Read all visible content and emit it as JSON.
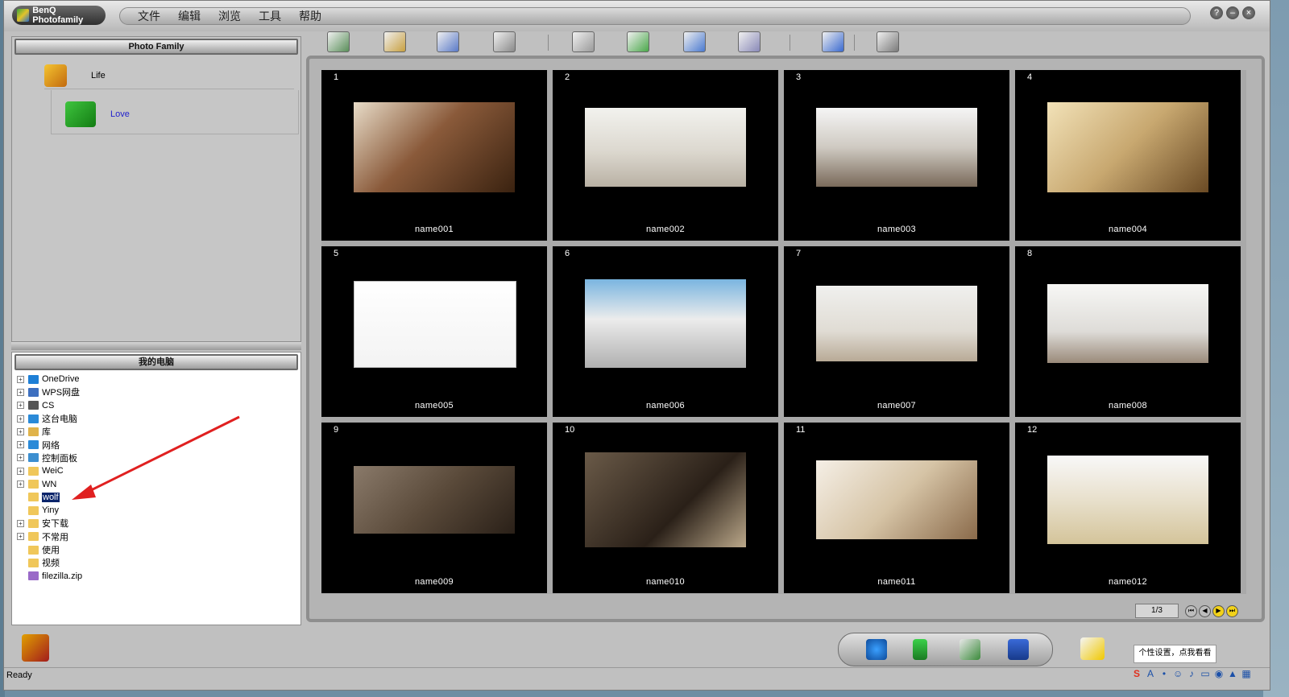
{
  "app": {
    "title": "BenQ Photofamily"
  },
  "menu": [
    "文件",
    "编辑",
    "浏览",
    "工具",
    "帮助"
  ],
  "window_buttons": [
    "?",
    "–",
    "×"
  ],
  "albums_panel": {
    "header": "Photo Family",
    "items": [
      {
        "label": "Life"
      },
      {
        "label": "Love"
      }
    ]
  },
  "tree_panel": {
    "header": "我的电脑",
    "items": [
      {
        "label": "OneDrive",
        "expander": "+",
        "icon": "cloud-icon"
      },
      {
        "label": "WPS网盘",
        "expander": "+",
        "icon": "cloud-outline-icon"
      },
      {
        "label": "CS",
        "expander": "+",
        "icon": "user-icon"
      },
      {
        "label": "这台电脑",
        "expander": "+",
        "icon": "monitor-icon"
      },
      {
        "label": "库",
        "expander": "+",
        "icon": "library-icon"
      },
      {
        "label": "网络",
        "expander": "+",
        "icon": "network-icon"
      },
      {
        "label": "控制面板",
        "expander": "+",
        "icon": "control-panel-icon"
      },
      {
        "label": "WeiC",
        "expander": "+",
        "icon": "folder-icon"
      },
      {
        "label": "WN",
        "expander": "+",
        "icon": "folder-icon"
      },
      {
        "label": "wolf",
        "expander": "",
        "icon": "folder-icon",
        "selected": true
      },
      {
        "label": "Yiny",
        "expander": "",
        "icon": "folder-icon"
      },
      {
        "label": "安下载",
        "expander": "+",
        "icon": "folder-icon"
      },
      {
        "label": "不常用",
        "expander": "+",
        "icon": "folder-icon"
      },
      {
        "label": "使用",
        "expander": "",
        "icon": "folder-icon"
      },
      {
        "label": "视频",
        "expander": "",
        "icon": "folder-icon"
      },
      {
        "label": "filezilla.zip",
        "expander": "",
        "icon": "zip-icon"
      }
    ]
  },
  "toolbar_icons": [
    "import-photo-icon",
    "album-icon",
    "scanner-icon",
    "save-disk-icon",
    "print-icon",
    "map-icon",
    "view-icon",
    "calculator-icon",
    "search-lens-icon",
    "grid-view-icon"
  ],
  "photos": [
    {
      "num": "1",
      "name": "name001"
    },
    {
      "num": "2",
      "name": "name002"
    },
    {
      "num": "3",
      "name": "name003"
    },
    {
      "num": "4",
      "name": "name004"
    },
    {
      "num": "5",
      "name": "name005"
    },
    {
      "num": "6",
      "name": "name006"
    },
    {
      "num": "7",
      "name": "name007"
    },
    {
      "num": "8",
      "name": "name008"
    },
    {
      "num": "9",
      "name": "name009"
    },
    {
      "num": "10",
      "name": "name010"
    },
    {
      "num": "11",
      "name": "name011"
    },
    {
      "num": "12",
      "name": "name012"
    }
  ],
  "pager": {
    "label": "1/3"
  },
  "bottom_icons": [
    "globe-icon",
    "phone-icon",
    "email-photo-icon",
    "fax-icon",
    "edit-paint-icon"
  ],
  "tooltip": "个性设置，点我看看",
  "status": "Ready",
  "colors": {
    "background": "#c0c0c0",
    "cell": "#000000",
    "selection": "#0a246a",
    "arrow": "#e02020"
  }
}
